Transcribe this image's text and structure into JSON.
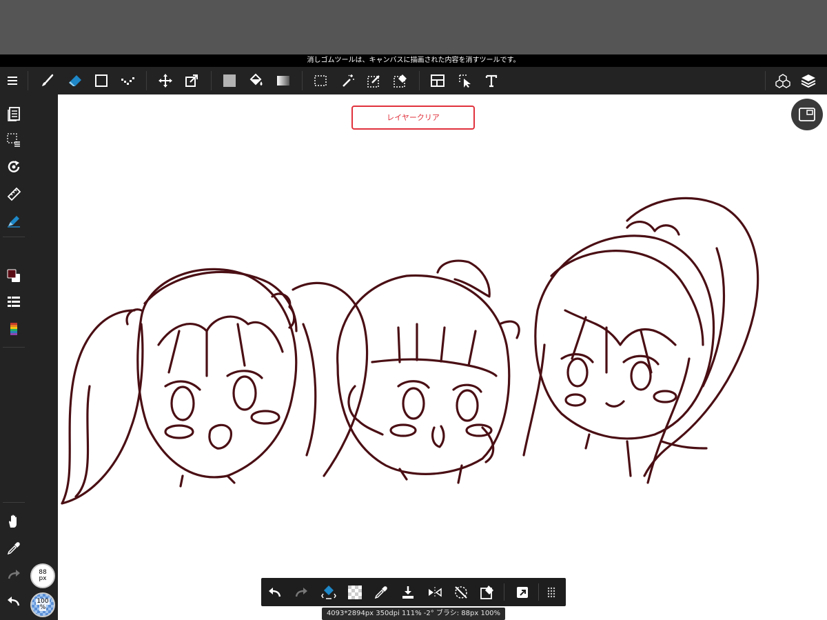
{
  "tip": {
    "text": "消しゴムツールは、キャンバスに描画された内容を消すツールです。"
  },
  "canvas": {
    "layer_clear_label": "レイヤークリア"
  },
  "brush_size": {
    "value": "88",
    "unit": "px"
  },
  "brush_opacity": {
    "value": "100",
    "unit": "%"
  },
  "status": {
    "text": "4093*2894px 350dpi 111% -2° ブラシ: 88px 100%"
  },
  "colors": {
    "accent": "#1e88c8",
    "layer_clear_red": "#e0313c",
    "line_color": "#4a0f14",
    "foreground_color": "#5a0c14",
    "toolbar_bg": "#232323"
  },
  "toolbar": {
    "left_icons": [
      "menu-icon",
      "brush-icon",
      "eraser-icon",
      "rectangle-icon",
      "dot-icon",
      "move-icon",
      "transform-icon",
      "fill-color-icon",
      "bucket-icon",
      "gradient-icon",
      "select-rect-icon",
      "magic-wand-icon",
      "select-pen-icon",
      "select-eraser-icon",
      "frame-divide-icon",
      "object-select-icon",
      "text-icon"
    ],
    "right_icons": [
      "3d-material-icon",
      "layers-icon"
    ]
  },
  "sidebar": {
    "icons": [
      "pages-icon",
      "selection-list-icon",
      "rotate-icon",
      "ruler-icon",
      "snap-pen-icon",
      "color-swatch-icon",
      "color-list-icon",
      "color-palette-icon",
      "hand-icon",
      "eyedropper-icon",
      "redo-icon",
      "undo-icon"
    ]
  },
  "bottombar": {
    "icons": [
      "undo-icon",
      "redo-icon",
      "eraser-toggle-icon",
      "transparent-color-icon",
      "eyedropper-icon",
      "save-icon",
      "flip-icon",
      "rotation-reset-icon",
      "select-tool-icon",
      "share-icon",
      "more-grid-icon"
    ]
  }
}
